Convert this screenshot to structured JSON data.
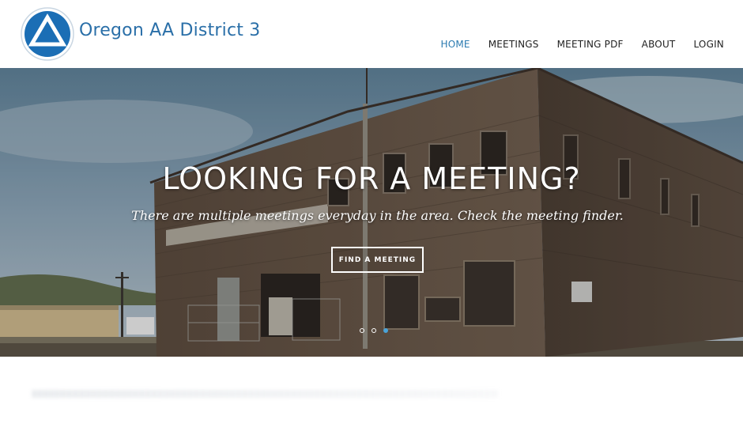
{
  "header": {
    "site_title": "Oregon AA District 3"
  },
  "nav": {
    "items": [
      {
        "label": "HOME",
        "active": true
      },
      {
        "label": "MEETINGS",
        "active": false
      },
      {
        "label": "MEETING PDF",
        "active": false
      },
      {
        "label": "ABOUT",
        "active": false
      },
      {
        "label": "LOGIN",
        "active": false
      }
    ]
  },
  "hero": {
    "title": "LOOKING FOR A MEETING?",
    "subtitle": "There are multiple meetings everyday in the area. Check the meeting finder.",
    "button_label": "FIND A MEETING",
    "slides": 3,
    "active_slide": 3
  },
  "colors": {
    "brand_blue": "#2a6fa8",
    "nav_active": "#2a7ab0",
    "logo_blue": "#1b6eb5"
  },
  "icons": {
    "logo": "aa-triangle-circle-logo"
  }
}
